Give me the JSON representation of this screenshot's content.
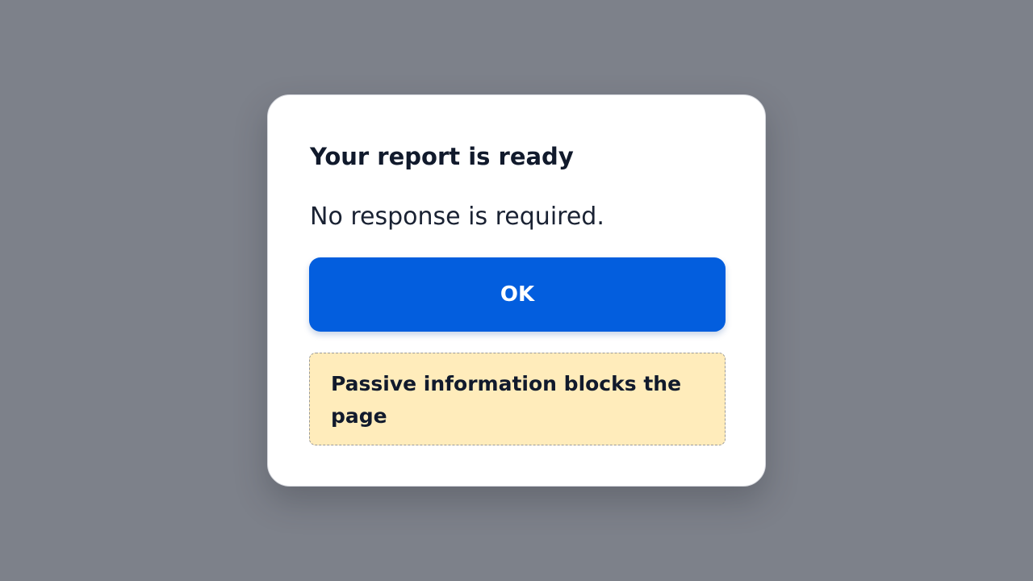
{
  "dialog": {
    "title": "Your report is ready",
    "message": "No response is required.",
    "ok_label": "OK",
    "note": "Passive information blocks the page"
  },
  "colors": {
    "backdrop": "#7d818a",
    "dialog_background": "#ffffff",
    "primary_button": "#035ede",
    "note_background": "#ffecbb",
    "text": "#111a2c"
  }
}
